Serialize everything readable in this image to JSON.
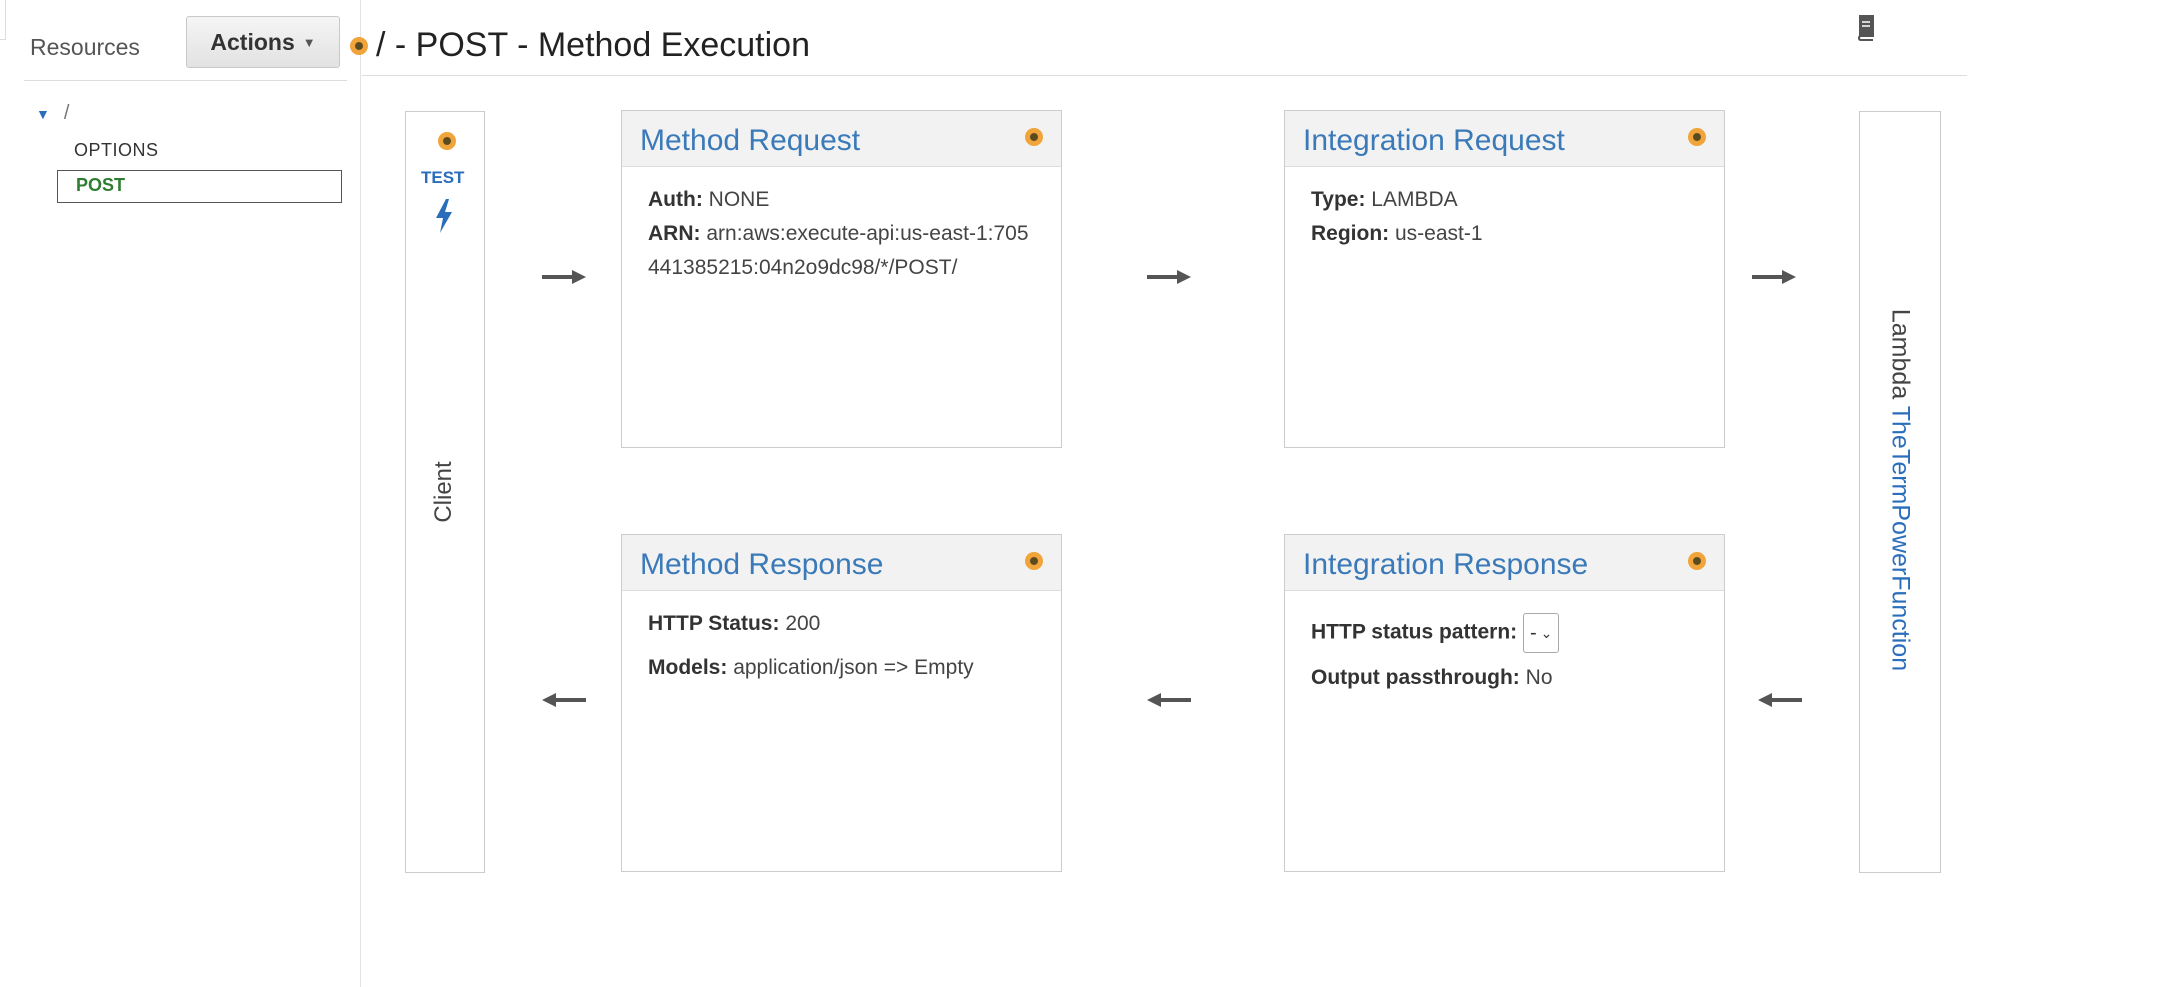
{
  "sidebar": {
    "resources_label": "Resources",
    "actions_label": "Actions",
    "tree": {
      "root": "/",
      "items": [
        {
          "label": "OPTIONS",
          "selected": false
        },
        {
          "label": "POST",
          "selected": true
        }
      ]
    }
  },
  "header": {
    "title": "/ - POST - Method Execution"
  },
  "client": {
    "test_label": "TEST",
    "label": "Client"
  },
  "method_request": {
    "title": "Method Request",
    "auth_label": "Auth:",
    "auth_value": "NONE",
    "arn_label": "ARN:",
    "arn_value": "arn:aws:execute-api:us-east-1:705441385215:04n2o9dc98/*/POST/"
  },
  "integration_request": {
    "title": "Integration Request",
    "type_label": "Type:",
    "type_value": "LAMBDA",
    "region_label": "Region:",
    "region_value": "us-east-1"
  },
  "method_response": {
    "title": "Method Response",
    "status_label": "HTTP Status:",
    "status_value": "200",
    "models_label": "Models:",
    "models_value": "application/json => Empty"
  },
  "integration_response": {
    "title": "Integration Response",
    "pattern_label": "HTTP status pattern:",
    "pattern_value": "-",
    "passthrough_label": "Output passthrough:",
    "passthrough_value": "No"
  },
  "lambda": {
    "prefix": "Lambda",
    "function_name": "TheTermPowerFunction"
  },
  "colors": {
    "link": "#3b7ab8",
    "status_dot": "#f0a43a",
    "selected_text": "#2e7d32"
  }
}
